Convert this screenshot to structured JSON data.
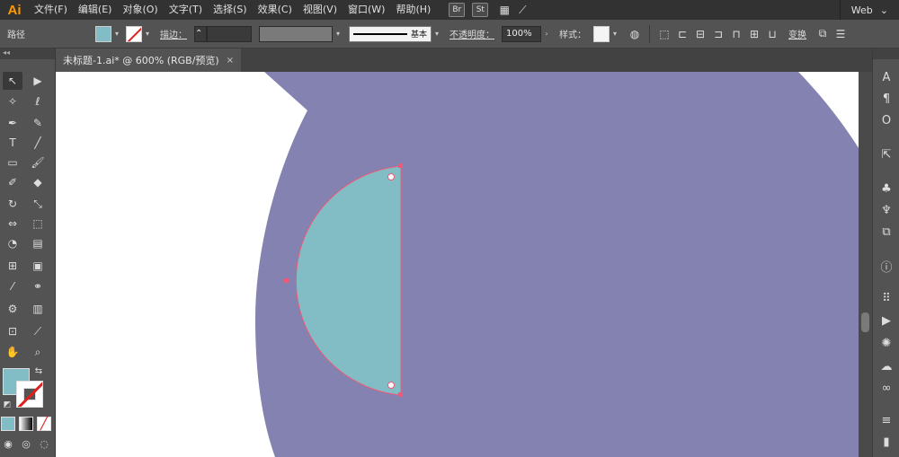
{
  "app": {
    "logo": "Ai"
  },
  "menu": [
    "文件(F)",
    "编辑(E)",
    "对象(O)",
    "文字(T)",
    "选择(S)",
    "效果(C)",
    "视图(V)",
    "窗口(W)",
    "帮助(H)"
  ],
  "bridge_badges": {
    "br": "Br",
    "st": "St"
  },
  "workspace": {
    "label": "Web",
    "chevron": "⌄"
  },
  "control_bar": {
    "object_type": "路径",
    "stroke_label": "描边：",
    "stroke_style": "基本",
    "opacity_label": "不透明度：",
    "opacity_value": "100%",
    "style_label": "样式：",
    "transform_label": "变换",
    "fill_color": "#82bcc4"
  },
  "document_tab": {
    "title": "未标题-1.ai* @ 600% (RGB/预览)",
    "close": "×"
  },
  "tools": {
    "fill_color": "#82bcc4",
    "stroke_color": "none"
  },
  "artwork": {
    "big_circle_color": "#8382b0",
    "half_circle_color": "#82bcc4",
    "path_stroke_color": "#ef5a78"
  }
}
